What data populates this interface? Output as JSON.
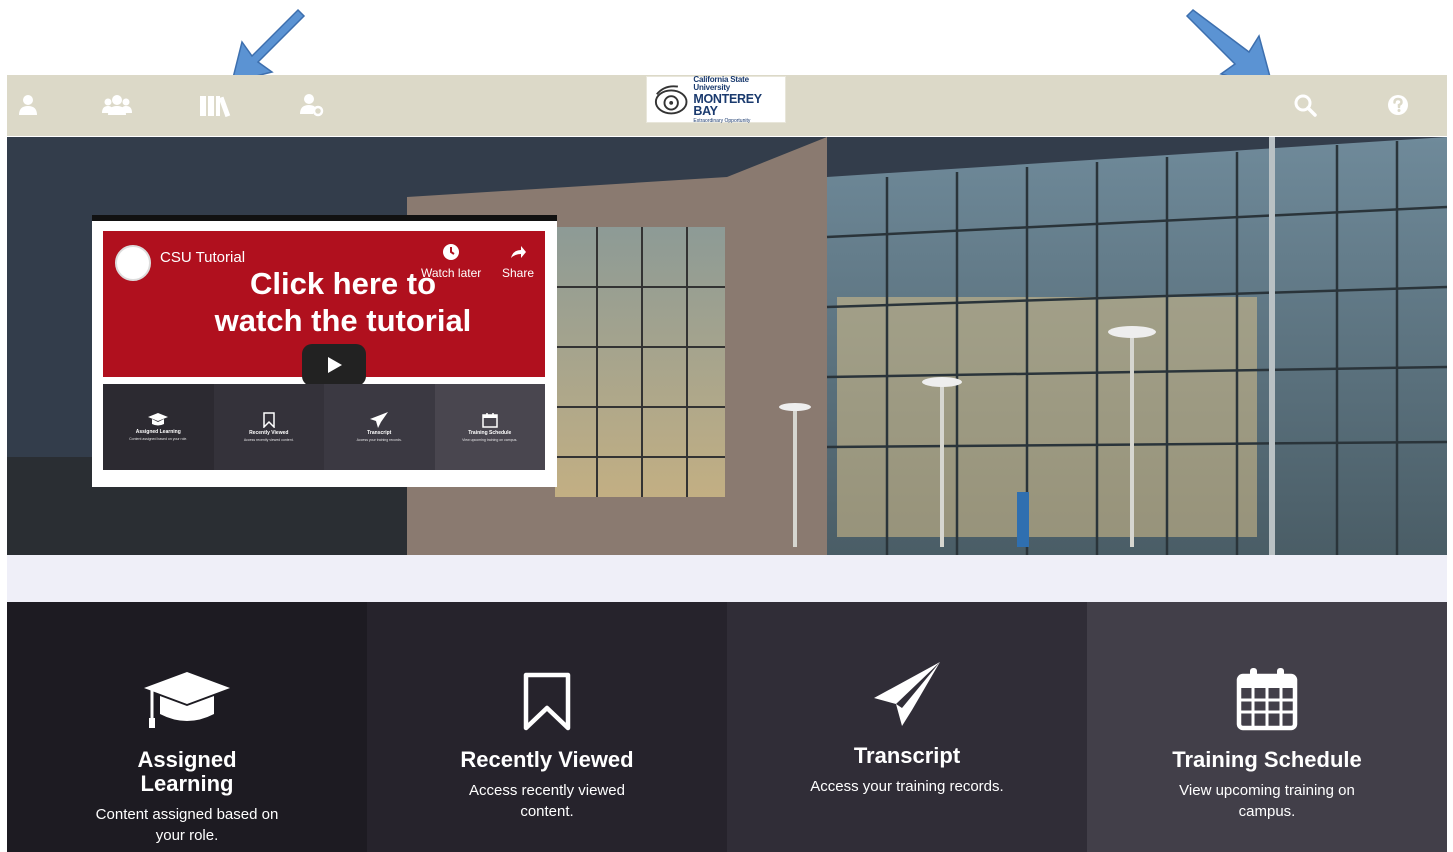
{
  "brand": {
    "logo_line1": "California State University",
    "logo_line2": "MONTEREY BAY",
    "logo_line3": "Extraordinary Opportunity"
  },
  "nav": {
    "icons": [
      "user-icon",
      "users-icon",
      "library-icon",
      "user-settings-icon",
      "search-icon",
      "help-icon"
    ]
  },
  "video": {
    "channel_title": "CSU Tutorial",
    "headline_line1": "Click here to",
    "headline_line2": "watch the tutorial",
    "watch_later": "Watch later",
    "share": "Share",
    "tiles": [
      {
        "title": "Assigned Learning",
        "desc": "Content assigned based on your role."
      },
      {
        "title": "Recently Viewed",
        "desc": "Access recently viewed content."
      },
      {
        "title": "Transcript",
        "desc": "Access your training records."
      },
      {
        "title": "Training Schedule",
        "desc": "View upcoming training on campus."
      }
    ]
  },
  "tiles": [
    {
      "title": "Assigned Learning",
      "desc": "Content assigned based on your role."
    },
    {
      "title": "Recently Viewed",
      "desc": "Access recently viewed content."
    },
    {
      "title": "Transcript",
      "desc": "Access your training records."
    },
    {
      "title": "Training Schedule",
      "desc": "View upcoming training on campus."
    }
  ],
  "colors": {
    "nav_bg": "#dcd9c8",
    "video_red": "#b0101e",
    "arrow_blue": "#5b93d3"
  }
}
